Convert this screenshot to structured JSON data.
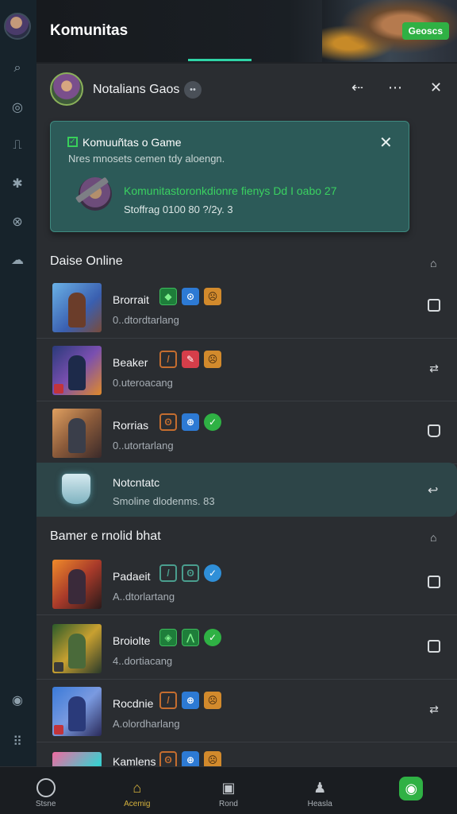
{
  "header": {
    "title": "Komunitas",
    "cta_label": "Geoscs"
  },
  "game": {
    "title": "Notalians Gaos",
    "badge": "••"
  },
  "notice": {
    "title": "Komuuñtas o Game",
    "subtitle": "Nres mnosets cemen tdy aloengn.",
    "line1": "Komunitastoronkdionre fienys Dd I oabo 27",
    "line2": "Stoffrag 0100 80 ?/2y. 3"
  },
  "sections": {
    "online_title": "Daise Online",
    "chat_title": "Bamer e rnolid bhat"
  },
  "online_rows": [
    {
      "name": "Brorrait",
      "sub": "0..dtordtarlang",
      "tags": [
        "green:◆",
        "blue:⊙",
        "orange:☹"
      ],
      "action": "box"
    },
    {
      "name": "Beaker",
      "sub": "0.uteroacang",
      "tags": [
        "outline:/",
        "red:✎",
        "orange:☹"
      ],
      "action": "swap"
    },
    {
      "name": "Rorrias",
      "sub": "0..utortarlang",
      "tags": [
        "outline:ʘ",
        "blue:⊕",
        "check:✓"
      ],
      "action": "box2"
    }
  ],
  "highlight": {
    "name": "Notcntatc",
    "sub": "Smoline dlodenms. 83",
    "action": "↩"
  },
  "chat_rows": [
    {
      "name": "Padaeit",
      "sub": "A..dtorlartang",
      "tags": [
        "teal:/",
        "teal:ʘ",
        "checkblue:✓"
      ],
      "action": "box"
    },
    {
      "name": "Broiolte",
      "sub": "4..dortiacang",
      "tags": [
        "green:◈",
        "green:⋀",
        "check:✓"
      ],
      "action": "box"
    },
    {
      "name": "Rocdnie",
      "sub": "A.olordharlang",
      "tags": [
        "outline:/",
        "blue:⊕",
        "orange:☹"
      ],
      "action": "swap"
    },
    {
      "name": "Kamlens",
      "sub": "",
      "tags": [
        "outline:ʘ",
        "blue:⊕",
        "orange:☹"
      ],
      "action": ""
    }
  ],
  "bottom_nav": [
    {
      "label": "Stsne",
      "icon": "home-circle-icon"
    },
    {
      "label": "Acemig",
      "icon": "community-icon",
      "active": true
    },
    {
      "label": "Rond",
      "icon": "store-icon"
    },
    {
      "label": "Heasla",
      "icon": "profile-icon"
    },
    {
      "label": "",
      "icon": "map-pin-icon"
    }
  ],
  "colors": {
    "accent_green": "#2fb144",
    "notice_bg": "#2c5a58",
    "tab_indicator": "#2fd3a6",
    "active_nav": "#d4b13d"
  }
}
